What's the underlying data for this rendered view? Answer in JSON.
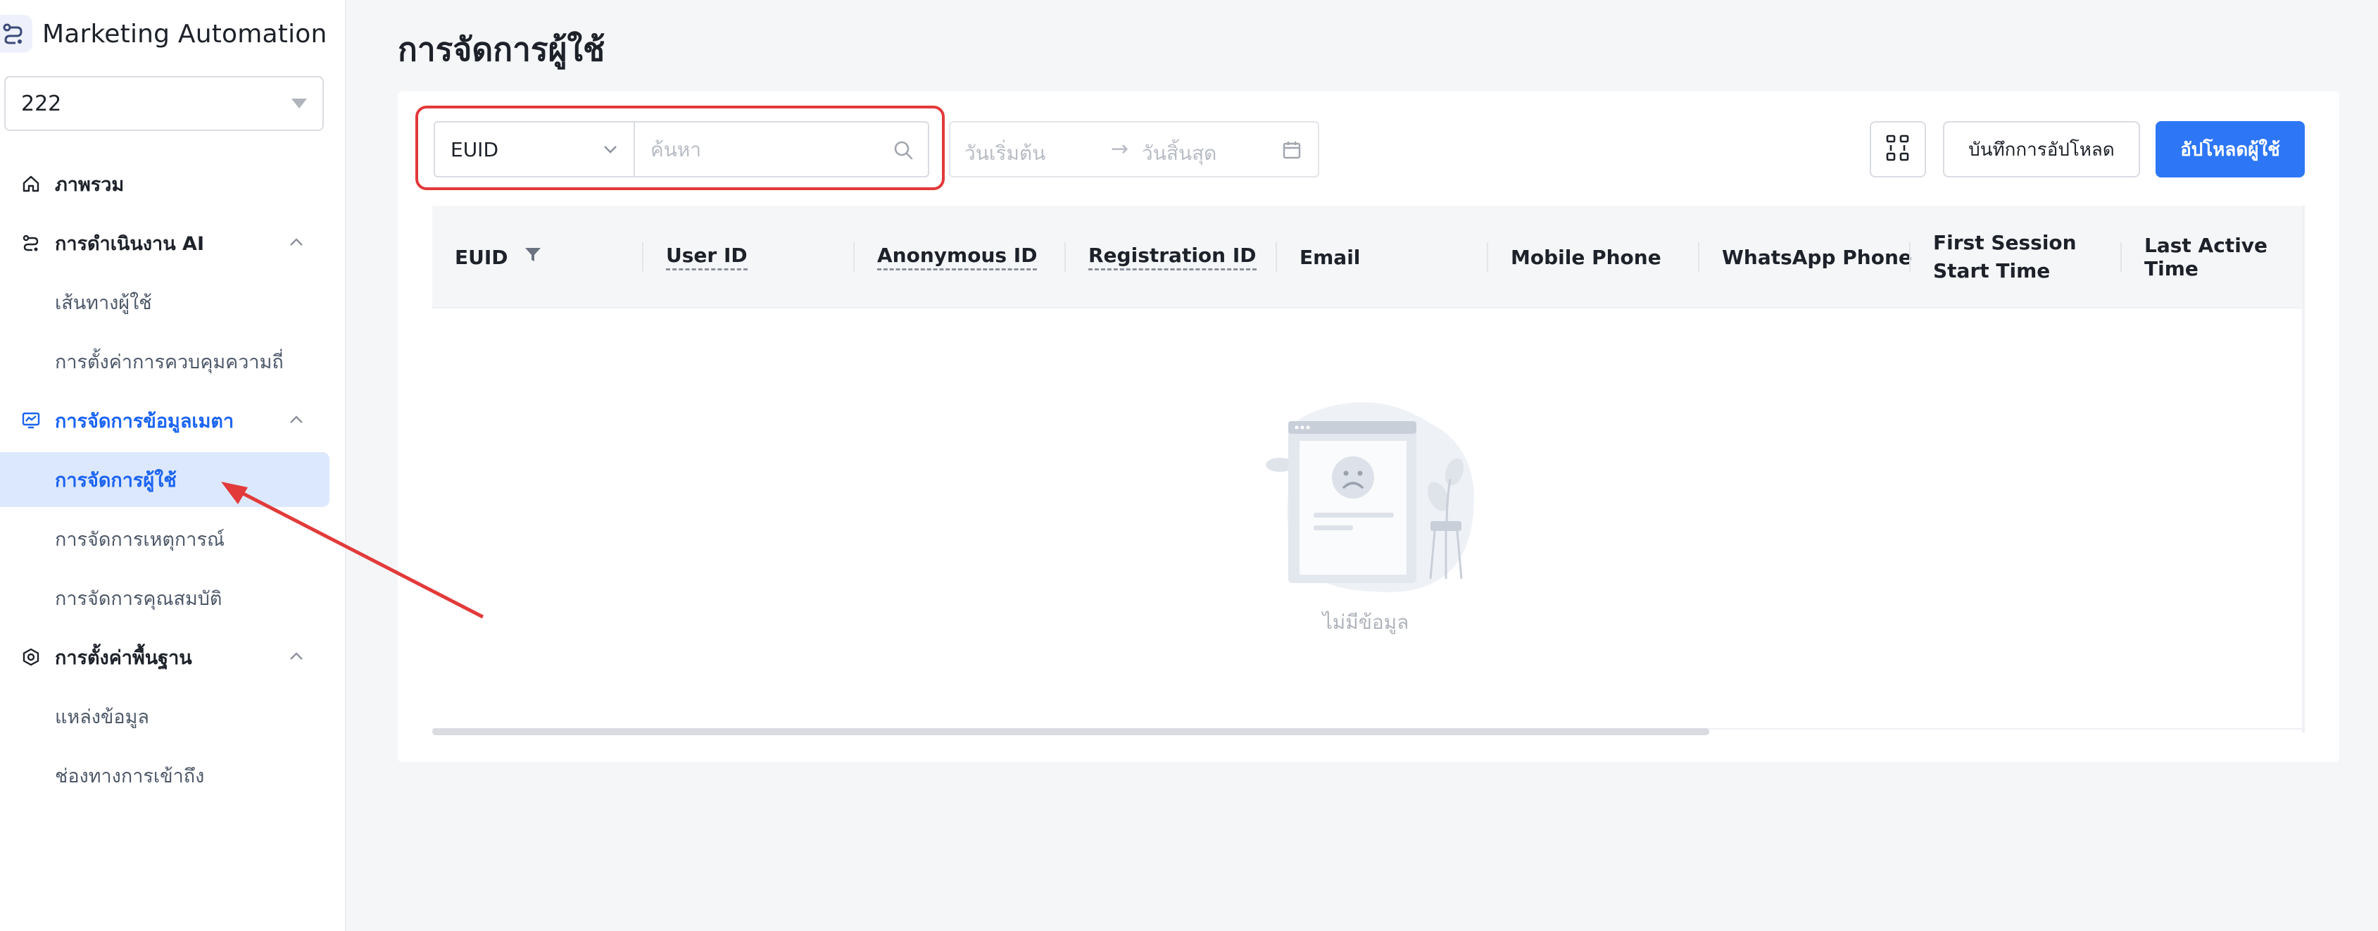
{
  "app": {
    "title": "Marketing Automation"
  },
  "project": {
    "value": "222"
  },
  "sidebar": {
    "items": [
      {
        "label": "ภาพรวม"
      },
      {
        "label": "การดำเนินงาน AI"
      },
      {
        "label": "เส้นทางผู้ใช้"
      },
      {
        "label": "การตั้งค่าการควบคุมความถี่"
      },
      {
        "label": "การจัดการข้อมูลเมตา"
      },
      {
        "label": "การจัดการผู้ใช้"
      },
      {
        "label": "การจัดการเหตุการณ์"
      },
      {
        "label": "การจัดการคุณสมบัติ"
      },
      {
        "label": "การตั้งค่าพื้นฐาน"
      },
      {
        "label": "แหล่งข้อมูล"
      },
      {
        "label": "ช่องทางการเข้าถึง"
      }
    ]
  },
  "page": {
    "title": "การจัดการผู้ใช้"
  },
  "filters": {
    "field": "EUID",
    "search_placeholder": "ค้นหา",
    "date_start_placeholder": "วันเริ่มต้น",
    "date_arrow": "→",
    "date_end_placeholder": "วันสิ้นสุด"
  },
  "toolbar": {
    "history_label": "บันทึกการอัปโหลด",
    "upload_label": "อัปโหลดผู้ใช้"
  },
  "table": {
    "columns": [
      "EUID",
      "User ID",
      "Anonymous ID",
      "Registration ID",
      "Email",
      "Mobile Phone",
      "WhatsApp Phone",
      "First Session\nStart Time",
      "Last Active Time"
    ],
    "empty_text": "ไม่มีข้อมูล"
  },
  "colors": {
    "accent": "#1b64f2",
    "primary_button": "#2d77f6",
    "highlight": "#e23a3a",
    "selected_bg": "#dce8fd"
  },
  "icons": {
    "overview": "home-icon",
    "ai": "flow-icon",
    "metadata": "chart-board-icon",
    "basic_settings": "hexagon-gear-icon",
    "column_settings": "columns-icon",
    "search": "search-icon",
    "calendar": "calendar-icon",
    "filter": "funnel-icon"
  }
}
